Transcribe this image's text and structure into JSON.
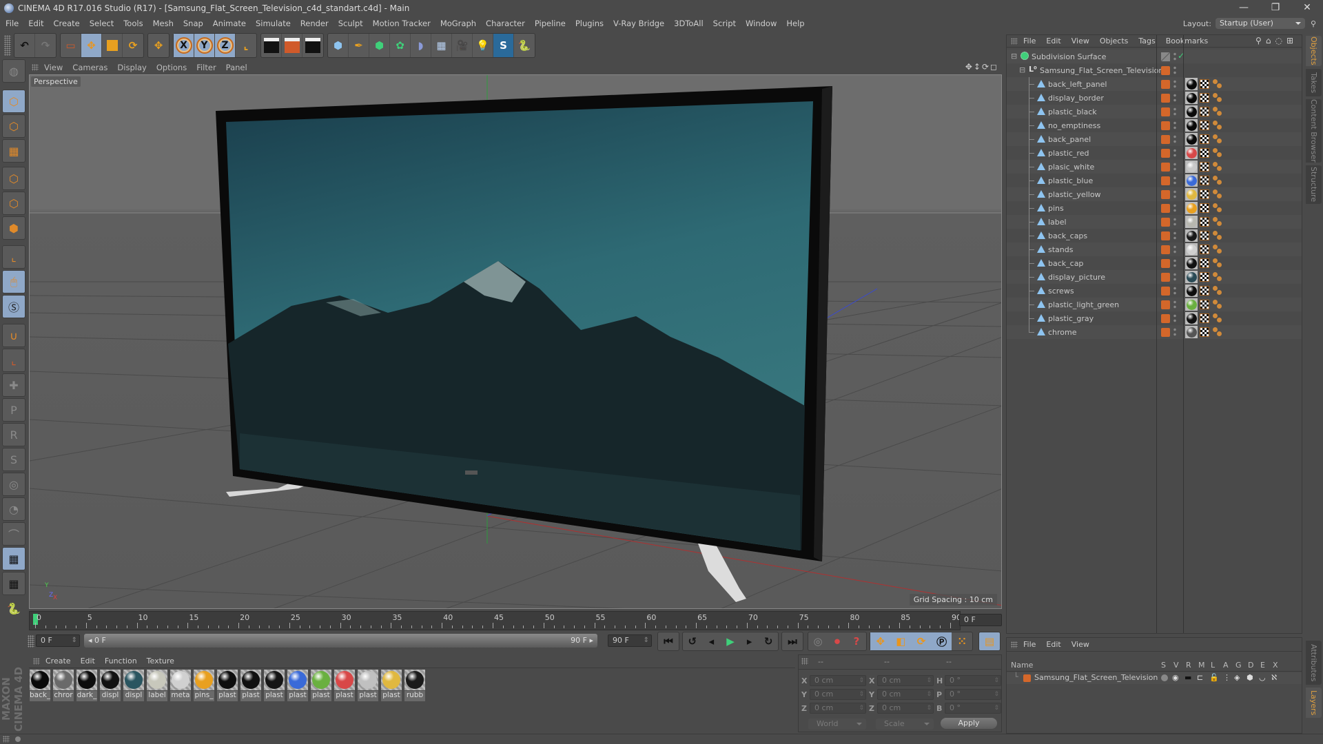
{
  "window": {
    "title": "CINEMA 4D R17.016 Studio (R17) - [Samsung_Flat_Screen_Television_c4d_standart.c4d] - Main",
    "controls": {
      "minimize": "—",
      "restore": "❐",
      "close": "✕"
    }
  },
  "menubar": {
    "items": [
      "File",
      "Edit",
      "Create",
      "Select",
      "Tools",
      "Mesh",
      "Snap",
      "Animate",
      "Simulate",
      "Render",
      "Sculpt",
      "Motion Tracker",
      "MoGraph",
      "Character",
      "Pipeline",
      "Plugins",
      "V-Ray Bridge",
      "3DToAll",
      "Script",
      "Window",
      "Help"
    ],
    "layout_label": "Layout:",
    "layout_value": "Startup (User)"
  },
  "toolbar": {
    "undo_icon": "↶",
    "redo_icon": "↷",
    "axis_x": "X",
    "axis_y": "Y",
    "axis_z": "Z"
  },
  "viewport": {
    "menu": [
      "View",
      "Cameras",
      "Display",
      "Options",
      "Filter",
      "Panel"
    ],
    "camera_label": "Perspective",
    "grid_spacing": "Grid Spacing : 10 cm",
    "nav_icons": "✥↕⟳◻",
    "axis_gizmo": {
      "y": "Y",
      "z": "Z",
      "x": "X"
    }
  },
  "timeline": {
    "ticks": [
      "0",
      "5",
      "10",
      "15",
      "20",
      "25",
      "30",
      "35",
      "40",
      "45",
      "50",
      "55",
      "60",
      "65",
      "70",
      "75",
      "80",
      "85",
      "90"
    ],
    "current_frame": "0 F",
    "start_field": "0 F",
    "range_start": "◂ 0 F",
    "range_end": "90 F ▸",
    "end_field": "90 F",
    "playhead_frame": 0,
    "max_frame": 90
  },
  "material_manager": {
    "menu": [
      "Create",
      "Edit",
      "Function",
      "Texture"
    ],
    "materials": [
      {
        "name": "back_",
        "color": "#0a0a0a"
      },
      {
        "name": "chror",
        "color": "#6a6a6a"
      },
      {
        "name": "dark_",
        "color": "#0d0d0d"
      },
      {
        "name": "displ",
        "color": "#121212"
      },
      {
        "name": "displ",
        "color": "#2a5560"
      },
      {
        "name": "label",
        "color": "#c8c8bc"
      },
      {
        "name": "meta",
        "color": "#d0d0d0"
      },
      {
        "name": "pins_",
        "color": "#e8a020"
      },
      {
        "name": "plast",
        "color": "#0e0e0e"
      },
      {
        "name": "plast",
        "color": "#101010"
      },
      {
        "name": "plast",
        "color": "#151515"
      },
      {
        "name": "plast",
        "color": "#3a6ad8"
      },
      {
        "name": "plast",
        "color": "#6ab040"
      },
      {
        "name": "plast",
        "color": "#d84848"
      },
      {
        "name": "plast",
        "color": "#c0c0c0"
      },
      {
        "name": "plast",
        "color": "#e0b840"
      },
      {
        "name": "rubb",
        "color": "#1a1a1a"
      }
    ]
  },
  "branding": "MAXON CINEMA 4D",
  "coordinates": {
    "headers": [
      "--",
      "--",
      "--"
    ],
    "rows": [
      {
        "l1": "X",
        "v1": "0 cm",
        "l2": "X",
        "v2": "0 cm",
        "l3": "H",
        "v3": "0 °"
      },
      {
        "l1": "Y",
        "v1": "0 cm",
        "l2": "Y",
        "v2": "0 cm",
        "l3": "P",
        "v3": "0 °"
      },
      {
        "l1": "Z",
        "v1": "0 cm",
        "l2": "Z",
        "v2": "0 cm",
        "l3": "B",
        "v3": "0 °"
      }
    ],
    "space": "World",
    "mode": "Scale",
    "apply_label": "Apply"
  },
  "object_manager": {
    "menu": [
      "File",
      "Edit",
      "View",
      "Objects",
      "Tags",
      "Bookmarks"
    ],
    "root": {
      "name": "Subdivision Surface"
    },
    "group": {
      "name": "Samsung_Flat_Screen_Television"
    },
    "objects": [
      {
        "name": "back_left_panel",
        "mat": "#0a0a0a"
      },
      {
        "name": "display_border",
        "mat": "#0a0a0a"
      },
      {
        "name": "plastic_black",
        "mat": "#0a0a0a"
      },
      {
        "name": "no_emptiness",
        "mat": "#0a0a0a"
      },
      {
        "name": "back_panel",
        "mat": "#0a0a0a"
      },
      {
        "name": "plastic_red",
        "mat": "#d84848"
      },
      {
        "name": "plasic_white",
        "mat": "#c8c8c8"
      },
      {
        "name": "plastic_blue",
        "mat": "#3a6ad8"
      },
      {
        "name": "plastic_yellow",
        "mat": "#e0b840"
      },
      {
        "name": "pins",
        "mat": "#e8a020"
      },
      {
        "name": "label",
        "mat": "#b8b8b0"
      },
      {
        "name": "back_caps",
        "mat": "#1a1a1a"
      },
      {
        "name": "stands",
        "mat": "#d0d0d0"
      },
      {
        "name": "back_cap",
        "mat": "#111111"
      },
      {
        "name": "display_picture",
        "mat": "#2a4a55"
      },
      {
        "name": "screws",
        "mat": "#0d0d0d"
      },
      {
        "name": "plastic_light_green",
        "mat": "#6ab040"
      },
      {
        "name": "plastic_gray",
        "mat": "#111111"
      },
      {
        "name": "chrome",
        "mat": "#555555"
      }
    ]
  },
  "layer_manager": {
    "menu": [
      "File",
      "Edit",
      "View"
    ],
    "columns": [
      "Name",
      "S",
      "V",
      "R",
      "M",
      "L",
      "A",
      "G",
      "D",
      "E",
      "X"
    ],
    "layers": [
      {
        "name": "Samsung_Flat_Screen_Television",
        "color": "#d4672a"
      }
    ]
  },
  "right_tabs": {
    "top": [
      {
        "label": "Objects",
        "active": true
      },
      {
        "label": "Takes"
      },
      {
        "label": "Content Browser"
      },
      {
        "label": "Structure"
      }
    ],
    "bottom": [
      {
        "label": "Attributes"
      },
      {
        "label": "Layers",
        "active": true
      }
    ]
  }
}
